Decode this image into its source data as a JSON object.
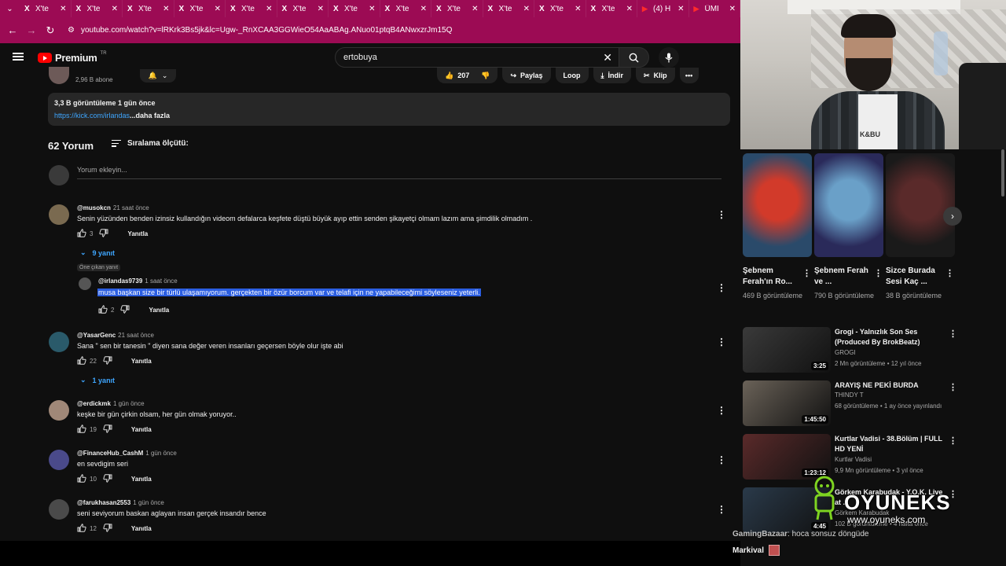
{
  "browser": {
    "tabs": [
      {
        "icon": "X",
        "title": "X'te",
        "kind": "x"
      },
      {
        "icon": "X",
        "title": "X'te",
        "kind": "x"
      },
      {
        "icon": "X",
        "title": "X'te",
        "kind": "x"
      },
      {
        "icon": "X",
        "title": "X'te",
        "kind": "x"
      },
      {
        "icon": "X",
        "title": "X'te",
        "kind": "x"
      },
      {
        "icon": "X",
        "title": "X'te",
        "kind": "x"
      },
      {
        "icon": "X",
        "title": "X'te",
        "kind": "x"
      },
      {
        "icon": "X",
        "title": "X'te",
        "kind": "x"
      },
      {
        "icon": "X",
        "title": "X'te",
        "kind": "x"
      },
      {
        "icon": "X",
        "title": "X'te",
        "kind": "x"
      },
      {
        "icon": "X",
        "title": "X'te",
        "kind": "x"
      },
      {
        "icon": "X",
        "title": "X'te",
        "kind": "x"
      },
      {
        "icon": "▶",
        "title": "(4) H",
        "kind": "yt"
      },
      {
        "icon": "▶",
        "title": "ÜMİ",
        "kind": "yt"
      }
    ],
    "tab_close": "✕",
    "url": "youtube.com/watch?v=lRKrk3Bs5jk&lc=Ugw-_RnXCAA3GGWieO54AaABAg.ANuo01ptqB4ANwxzrJm15Q",
    "accent": "#9c0b54"
  },
  "header": {
    "brand": "Premium",
    "brand_region": "TR",
    "search_query": "ertobuya"
  },
  "channel": {
    "subscribers": "2,96 B abone"
  },
  "actions": {
    "likes": "207",
    "share": "Paylaş",
    "loop": "Loop",
    "download": "İndir",
    "clip": "Klip",
    "more": "•••"
  },
  "description": {
    "stats": "3,3 B görüntüleme  1 gün önce",
    "link": "https://kick.com/irlandas",
    "more": "...daha fazla"
  },
  "comments_header": {
    "count": "62 Yorum",
    "sort_label": "Sıralama ölçütü:",
    "add_placeholder": "Yorum ekleyin..."
  },
  "comments": [
    {
      "author": "@musokcn",
      "time": "21 saat önce",
      "text": "Senin yüzünden benden izinsiz kullandığın videom defalarca keşfete düştü büyük ayıp ettin senden şikayetçi olmam lazım ama şimdilik olmadım .",
      "likes": "3",
      "reply": "Yanıtla",
      "replies": "9 yanıt",
      "avatar_color": "#7a6a50"
    },
    {
      "author": "@YasarGenc",
      "time": "21 saat önce",
      "text": "Sana \" sen bir tanesin \" diyen sana değer veren insanları geçersen böyle olur işte abi",
      "likes": "22",
      "reply": "Yanıtla",
      "replies": "1 yanıt",
      "avatar_color": "#2a5a6a"
    },
    {
      "author": "@erdickmk",
      "time": "1 gün önce",
      "text": "keşke bir gün çirkin olsam, her gün olmak yoruyor..",
      "likes": "19",
      "reply": "Yanıtla",
      "avatar_color": "#a08878"
    },
    {
      "author": "@FinanceHub_CashM",
      "time": "1 gün önce",
      "text": "en sevdigim seri",
      "likes": "10",
      "reply": "Yanıtla",
      "avatar_color": "#4a4a8a"
    },
    {
      "author": "@farukhasan2553",
      "time": "1 gün önce",
      "text": "seni seviyorum baskan aglayan insan gerçek insandır bence",
      "likes": "12",
      "reply": "Yanıtla",
      "avatar_color": "#4a4a4a"
    }
  ],
  "pinned_reply": {
    "badge": "Öne çıkan yanıt",
    "author": "@irlandas9739",
    "time": "1 saat önce",
    "text": "musa başkan size bir türlü ulaşamıyorum. gerçekten bir özür borcum var ve telafi için ne yapabileceğimi söyleseniz yeterli.",
    "likes": "2",
    "reply": "Yanıtla"
  },
  "webcam": {
    "shirt_text": "K&BU"
  },
  "shorts": [
    {
      "title": "Şebnem Ferah'ın Ro...",
      "views": "469 B görüntüleme",
      "color1": "#d23a2a",
      "color2": "#2a4a6a"
    },
    {
      "title": "Şebnem Ferah ve ...",
      "views": "790 B görüntüleme",
      "color1": "#6aa0c8",
      "color2": "#2a2a5a"
    },
    {
      "title": "Sizce Burada Sesi Kaç ...",
      "views": "38 B görüntüleme",
      "color1": "#5a2a2a",
      "color2": "#1a1a1a"
    }
  ],
  "videos": [
    {
      "title": "Grogi - Yalnızlık Son Ses (Produced By BrokBeatz)",
      "channel": "GROGI",
      "meta": "2 Mn görüntüleme • 12 yıl önce",
      "duration": "3:25",
      "color": "#3a3a3a"
    },
    {
      "title": "ARAYIŞ NE PEKİ BURDA",
      "channel": "THINDY T",
      "meta": "68 görüntüleme • 1 ay önce yayınlandı",
      "duration": "1:45:50",
      "color": "#6a6258"
    },
    {
      "title": "Kurtlar Vadisi - 38.Bölüm | FULL HD YENİ",
      "channel": "Kurtlar Vadisi",
      "meta": "9,9 Mn görüntüleme • 3 yıl önce",
      "duration": "1:23:12",
      "color": "#5a2a2a"
    },
    {
      "title": "Görkem Karabudak - Y.O.K. Live at ...",
      "channel": "Görkem Karabudak",
      "meta": "102 B görüntüleme • 4 hafta önce",
      "duration": "4:45",
      "color": "#2a3a4a"
    }
  ],
  "watermark": {
    "brand": "OYUNEKS",
    "url": "www.oyuneks.com",
    "color": "#7ed321"
  },
  "chat": [
    {
      "user": "GamingBazaar",
      "message": ": hoca sonsuz döngüde"
    },
    {
      "user": "Markival",
      "message": ""
    }
  ]
}
